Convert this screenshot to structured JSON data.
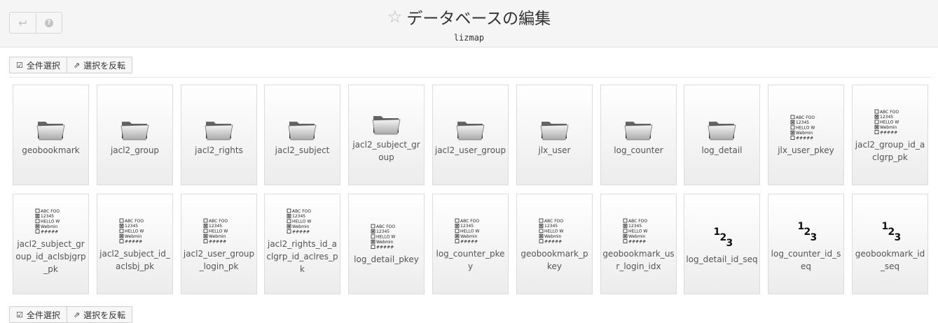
{
  "header": {
    "title": "データベースの編集",
    "subtitle": "lizmap",
    "back_icon": "back-arrow-icon",
    "help_icon": "help-icon"
  },
  "toolbar": {
    "select_all_label": "全件選択",
    "invert_label": "選択を反転"
  },
  "tiles": [
    {
      "label": "geobookmark",
      "type": "table"
    },
    {
      "label": "jacl2_group",
      "type": "table"
    },
    {
      "label": "jacl2_rights",
      "type": "table"
    },
    {
      "label": "jacl2_subject",
      "type": "table"
    },
    {
      "label": "jacl2_subject_group",
      "type": "table"
    },
    {
      "label": "jacl2_user_group",
      "type": "table"
    },
    {
      "label": "jlx_user",
      "type": "table"
    },
    {
      "label": "log_counter",
      "type": "table"
    },
    {
      "label": "log_detail",
      "type": "table"
    },
    {
      "label": "jlx_user_pkey",
      "type": "index"
    },
    {
      "label": "jacl2_group_id_aclgrp_pk",
      "type": "index"
    },
    {
      "label": "jacl2_subject_group_id_aclsbjgrp_pk",
      "type": "index"
    },
    {
      "label": "jacl2_subject_id_aclsbj_pk",
      "type": "index"
    },
    {
      "label": "jacl2_user_group_login_pk",
      "type": "index"
    },
    {
      "label": "jacl2_rights_id_aclgrp_id_aclres_pk",
      "type": "index"
    },
    {
      "label": "log_detail_pkey",
      "type": "index"
    },
    {
      "label": "log_counter_pkey",
      "type": "index"
    },
    {
      "label": "geobookmark_pkey",
      "type": "index"
    },
    {
      "label": "geobookmark_usr_login_idx",
      "type": "index"
    },
    {
      "label": "log_detail_id_seq",
      "type": "sequence"
    },
    {
      "label": "log_counter_id_seq",
      "type": "sequence"
    },
    {
      "label": "geobookmark_id_seq",
      "type": "sequence"
    }
  ],
  "index_icon_lines": [
    "ABC FOO",
    "12345",
    "HELLO W",
    "Webmin",
    "#####"
  ],
  "sequence_digits": [
    "1",
    "2",
    "3"
  ]
}
